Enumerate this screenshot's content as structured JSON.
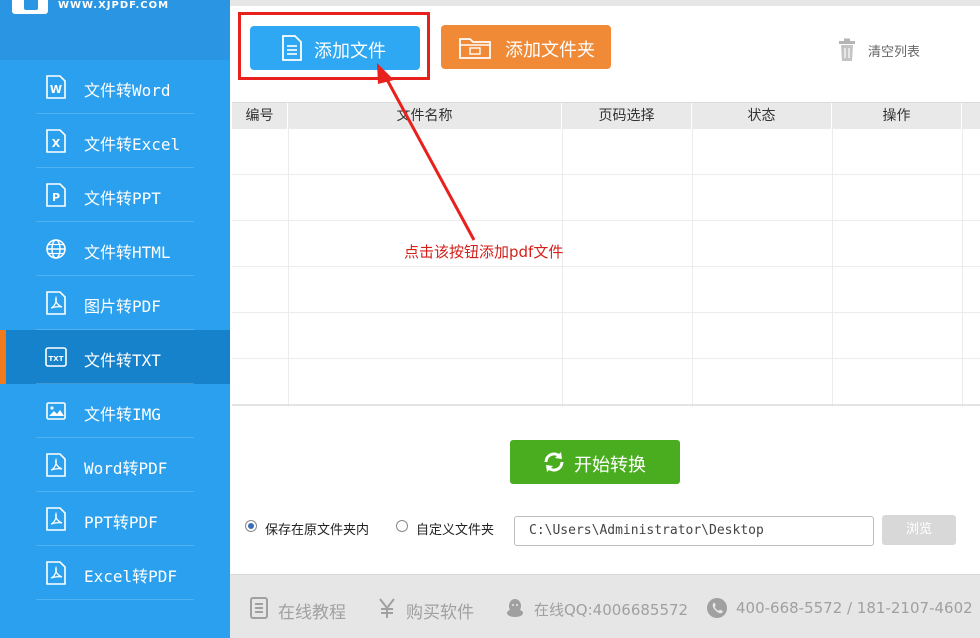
{
  "brand": {
    "url": "WWW.XJPDF.COM",
    "accent": "#2aa0ee",
    "active_accent": "#f07b1d"
  },
  "sidebar": {
    "items": [
      {
        "label": "文件转Word",
        "icon": "word-file-icon"
      },
      {
        "label": "文件转Excel",
        "icon": "excel-file-icon"
      },
      {
        "label": "文件转PPT",
        "icon": "ppt-file-icon"
      },
      {
        "label": "文件转HTML",
        "icon": "globe-icon"
      },
      {
        "label": "图片转PDF",
        "icon": "pdf-file-icon"
      },
      {
        "label": "文件转TXT",
        "icon": "txt-file-icon",
        "active": true
      },
      {
        "label": "文件转IMG",
        "icon": "image-icon"
      },
      {
        "label": "Word转PDF",
        "icon": "pdf-file-icon"
      },
      {
        "label": "PPT转PDF",
        "icon": "pdf-file-icon"
      },
      {
        "label": "Excel转PDF",
        "icon": "pdf-file-icon"
      }
    ]
  },
  "toolbar": {
    "add_file": "添加文件",
    "add_folder": "添加文件夹",
    "clear_list": "清空列表"
  },
  "table": {
    "headers": [
      "编号",
      "文件名称",
      "页码选择",
      "状态",
      "操作"
    ]
  },
  "annotation": {
    "text": "点击该按钮添加pdf文件",
    "color": "#d4201a"
  },
  "convert": {
    "start_label": "开始转换"
  },
  "output": {
    "option_original": "保存在原文件夹内",
    "option_custom": "自定义文件夹",
    "selected": "original",
    "path": "C:\\Users\\Administrator\\Desktop",
    "browse_label": "浏览"
  },
  "footer": {
    "tutorial": "在线教程",
    "buy": "购买软件",
    "qq": "在线QQ:4006685572",
    "phone": "400-668-5572 / 181-2107-4602"
  }
}
